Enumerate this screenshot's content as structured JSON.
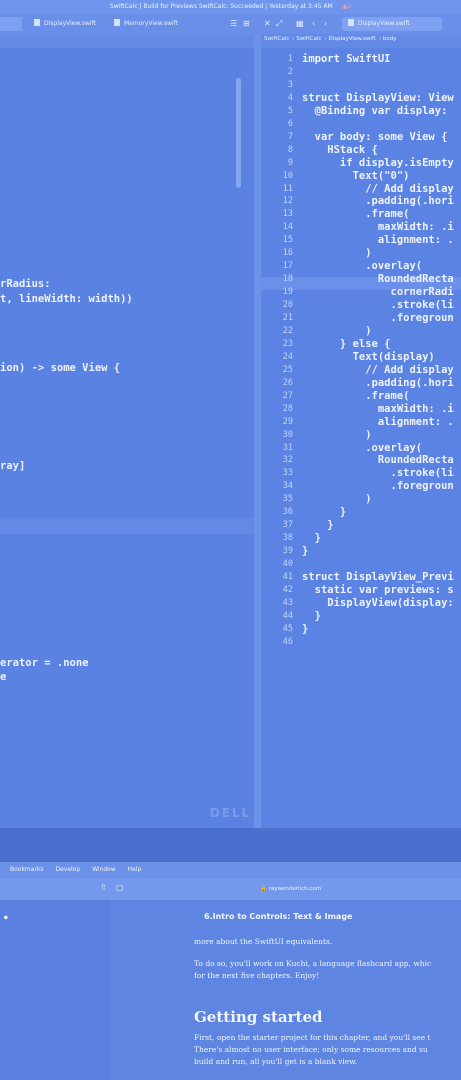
{
  "window": {
    "title": "SwiftCalc | Build for Previews SwiftCalc: Succeeded | Yesterday at 3:45 AM",
    "warning": "▲2"
  },
  "tabs": [
    {
      "label": "DisplayView.swift"
    },
    {
      "label": "MemoryView.swift"
    },
    {
      "label": "DisplayView.swift"
    }
  ],
  "breadcrumb": [
    "SwiftCalc",
    "SwiftCalc",
    "DisplayView.swift",
    "body"
  ],
  "left_code": [
    {
      "text": "rRadius:"
    },
    {
      "text": "t, lineWidth: width))"
    },
    {
      "text": "ion) -> some View {"
    },
    {
      "text": "ray]"
    },
    {
      "text": "erator = .none"
    },
    {
      "text": "e"
    }
  ],
  "right_code": [
    {
      "n": "1",
      "text": "import SwiftUI"
    },
    {
      "n": "2",
      "text": ""
    },
    {
      "n": "3",
      "text": ""
    },
    {
      "n": "4",
      "text": "struct DisplayView: View"
    },
    {
      "n": "5",
      "text": "  @Binding var display:"
    },
    {
      "n": "6",
      "text": ""
    },
    {
      "n": "7",
      "text": "  var body: some View {"
    },
    {
      "n": "8",
      "text": "    HStack {"
    },
    {
      "n": "9",
      "text": "      if display.isEmpty"
    },
    {
      "n": "10",
      "text": "        Text(\"0\")"
    },
    {
      "n": "11",
      "text": "          // Add display"
    },
    {
      "n": "12",
      "text": "          .padding(.hori"
    },
    {
      "n": "13",
      "text": "          .frame("
    },
    {
      "n": "14",
      "text": "            maxWidth: .i"
    },
    {
      "n": "15",
      "text": "            alignment: ."
    },
    {
      "n": "16",
      "text": "          )"
    },
    {
      "n": "17",
      "text": "          .overlay("
    },
    {
      "n": "18",
      "text": "            RoundedRecta"
    },
    {
      "n": "19",
      "text": "              cornerRadi"
    },
    {
      "n": "20",
      "text": "              .stroke(li"
    },
    {
      "n": "21",
      "text": "              .foregroun"
    },
    {
      "n": "22",
      "text": "          )"
    },
    {
      "n": "23",
      "text": "      } else {"
    },
    {
      "n": "24",
      "text": "        Text(display)"
    },
    {
      "n": "25",
      "text": "          // Add display"
    },
    {
      "n": "26",
      "text": "          .padding(.hori"
    },
    {
      "n": "27",
      "text": "          .frame("
    },
    {
      "n": "28",
      "text": "            maxWidth: .i"
    },
    {
      "n": "29",
      "text": "            alignment: ."
    },
    {
      "n": "30",
      "text": "          )"
    },
    {
      "n": "31",
      "text": "          .overlay("
    },
    {
      "n": "32",
      "text": "            RoundedRecta"
    },
    {
      "n": "33",
      "text": "              .stroke(li"
    },
    {
      "n": "34",
      "text": "              .foregroun"
    },
    {
      "n": "35",
      "text": "          )"
    },
    {
      "n": "36",
      "text": "      }"
    },
    {
      "n": "37",
      "text": "    }"
    },
    {
      "n": "38",
      "text": "  }"
    },
    {
      "n": "39",
      "text": "}"
    },
    {
      "n": "40",
      "text": ""
    },
    {
      "n": "41",
      "text": "struct DisplayView_Previ"
    },
    {
      "n": "42",
      "text": "  static var previews: s"
    },
    {
      "n": "43",
      "text": "    DisplayView(display:"
    },
    {
      "n": "44",
      "text": "  }"
    },
    {
      "n": "45",
      "text": "}"
    },
    {
      "n": "46",
      "text": ""
    }
  ],
  "monitor_brand": "DELL",
  "browser": {
    "menu": [
      "Bookmarks",
      "Develop",
      "Window",
      "Help"
    ],
    "url": "raywenderlich.com",
    "chapter_title": "6.Intro to Controls: Text & Image",
    "paragraphs": [
      "more about the SwiftUI equivalents.",
      "To do so, you'll work on Kuchi, a language flashcard app, whic",
      "for the next five chapters. Enjoy!"
    ],
    "heading": "Getting started",
    "paragraphs2": [
      "First, open the starter project for this chapter, and you'll see t",
      "There's almost no user interface; only some resources and su",
      "build and run, all you'll get is a blank view."
    ]
  },
  "colors": {
    "accent": "#5b83e3"
  }
}
